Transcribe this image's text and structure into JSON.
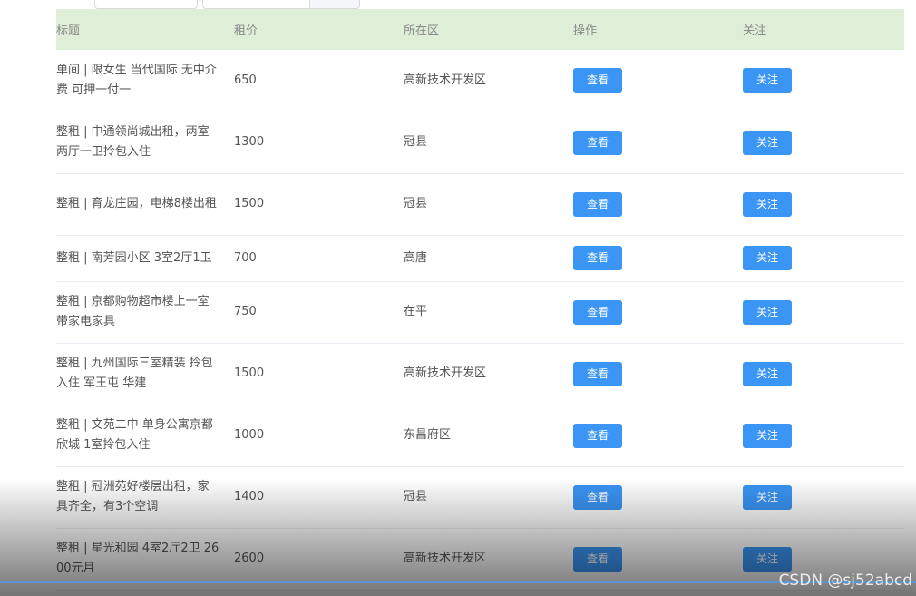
{
  "table": {
    "headers": {
      "title": "标题",
      "price": "租价",
      "area": "所在区",
      "operation": "操作",
      "follow": "关注"
    },
    "rows": [
      {
        "title": "单间 | 限女生 当代国际 无中介费 可押一付一",
        "price": "650",
        "area": "高新技术开发区",
        "view_label": "查看",
        "follow_label": "关注"
      },
      {
        "title": "整租 | 中通领尚城出租，两室两厅一卫拎包入住",
        "price": "1300",
        "area": "冠县",
        "view_label": "查看",
        "follow_label": "关注"
      },
      {
        "title": "整租 | 育龙庄园，电梯8楼出租",
        "price": "1500",
        "area": "冠县",
        "view_label": "查看",
        "follow_label": "关注"
      },
      {
        "title": "整租 | 南芳园小区 3室2厅1卫",
        "price": "700",
        "area": "高唐",
        "view_label": "查看",
        "follow_label": "关注"
      },
      {
        "title": "整租 | 京都购物超市楼上一室带家电家具",
        "price": "750",
        "area": "在平",
        "view_label": "查看",
        "follow_label": "关注"
      },
      {
        "title": "整租 | 九州国际三室精装 拎包入住 军王屯 华建",
        "price": "1500",
        "area": "高新技术开发区",
        "view_label": "查看",
        "follow_label": "关注"
      },
      {
        "title": "整租 | 文苑二中 单身公寓京都欣城 1室拎包入住",
        "price": "1000",
        "area": "东昌府区",
        "view_label": "查看",
        "follow_label": "关注"
      },
      {
        "title": "整租 | 冠洲苑好楼层出租，家具齐全，有3个空调",
        "price": "1400",
        "area": "冠县",
        "view_label": "查看",
        "follow_label": "关注"
      },
      {
        "title": "整租 | 星光和园 4室2厅2卫 2600元月",
        "price": "2600",
        "area": "高新技术开发区",
        "view_label": "查看",
        "follow_label": "关注"
      }
    ]
  },
  "watermark": "CSDN @sj52abcd",
  "colors": {
    "header_bg": "#dfeed7",
    "button": "#3a95f4"
  }
}
